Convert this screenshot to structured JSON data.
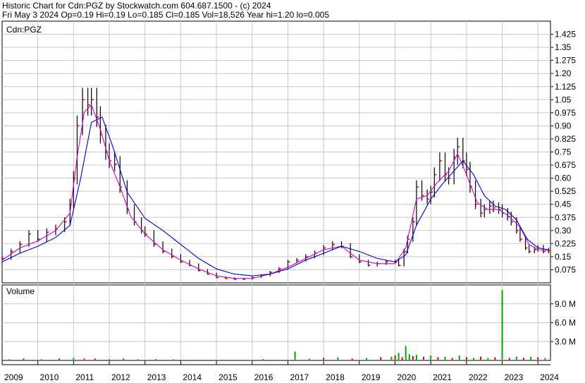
{
  "header": {
    "line1": "Historic Chart for Cdn:PGZ by Stockwatch.com 604.687.1500 - (c) 2024",
    "line2": "Fri May  3 2024   Op=0.19  Hi=0.19  Lo=0.185  Cl=0.185  Vol=18,526  Year hi=1.20  lo=0.005"
  },
  "colors": {
    "price_bar": "#000000",
    "close_tick": "#cc0000",
    "ma_short": "#cc00cc",
    "ma_long": "#0000cc",
    "volume_up": "#00aa00",
    "volume_down": "#cc0000",
    "grid": "#c8c8c8"
  },
  "chart_data": [
    {
      "type": "line",
      "title": "",
      "panel_label": "Cdn:PGZ",
      "grid": true,
      "y_ticks": [
        "1.425",
        "1.35",
        "1.275",
        "1.20",
        "1.125",
        "1.05",
        "0.975",
        "0.90",
        "0.825",
        "0.75",
        "0.675",
        "0.60",
        "0.525",
        "0.45",
        "0.375",
        "0.30",
        "0.225",
        "0.15",
        "0.075"
      ],
      "ylim": [
        0.0,
        1.5
      ],
      "xlim": [
        2009.0,
        2024.35
      ],
      "series": [
        {
          "key": "price",
          "x": [
            2009.0,
            2009.25,
            2009.5,
            2009.75,
            2010.0,
            2010.25,
            2010.5,
            2010.75,
            2010.9,
            2011.0,
            2011.1,
            2011.25,
            2011.4,
            2011.5,
            2011.65,
            2011.75,
            2011.9,
            2012.0,
            2012.15,
            2012.3,
            2012.5,
            2012.7,
            2012.9,
            2013.0,
            2013.25,
            2013.5,
            2013.75,
            2014.0,
            2014.25,
            2014.5,
            2014.75,
            2015.0,
            2015.25,
            2015.5,
            2015.75,
            2016.0,
            2016.25,
            2016.5,
            2016.75,
            2017.0,
            2017.25,
            2017.5,
            2017.75,
            2018.0,
            2018.25,
            2018.5,
            2018.75,
            2019.0,
            2019.25,
            2019.5,
            2019.75,
            2020.0,
            2020.1,
            2020.25,
            2020.35,
            2020.5,
            2020.6,
            2020.75,
            2020.9,
            2021.0,
            2021.1,
            2021.25,
            2021.4,
            2021.5,
            2021.65,
            2021.75,
            2021.9,
            2022.0,
            2022.1,
            2022.25,
            2022.4,
            2022.5,
            2022.65,
            2022.75,
            2022.9,
            2023.0,
            2023.15,
            2023.25,
            2023.4,
            2023.5,
            2023.65,
            2023.75,
            2023.9,
            2024.0,
            2024.15,
            2024.3
          ],
          "y": [
            0.14,
            0.18,
            0.22,
            0.28,
            0.25,
            0.29,
            0.31,
            0.35,
            0.45,
            0.6,
            0.9,
            1.05,
            1.02,
            1.05,
            0.95,
            0.85,
            0.75,
            0.7,
            0.68,
            0.55,
            0.42,
            0.35,
            0.3,
            0.28,
            0.22,
            0.18,
            0.15,
            0.12,
            0.1,
            0.07,
            0.05,
            0.03,
            0.025,
            0.02,
            0.02,
            0.03,
            0.04,
            0.06,
            0.08,
            0.12,
            0.13,
            0.15,
            0.17,
            0.2,
            0.22,
            0.21,
            0.15,
            0.12,
            0.1,
            0.11,
            0.12,
            0.12,
            0.1,
            0.18,
            0.25,
            0.35,
            0.55,
            0.5,
            0.48,
            0.52,
            0.62,
            0.7,
            0.62,
            0.6,
            0.72,
            0.78,
            0.7,
            0.65,
            0.55,
            0.45,
            0.4,
            0.42,
            0.44,
            0.43,
            0.42,
            0.4,
            0.38,
            0.35,
            0.3,
            0.25,
            0.2,
            0.18,
            0.19,
            0.2,
            0.18,
            0.185
          ]
        },
        {
          "key": "ma_short",
          "x": [
            2009.0,
            2009.5,
            2010.0,
            2010.5,
            2010.9,
            2011.1,
            2011.3,
            2011.5,
            2011.75,
            2012.0,
            2012.3,
            2012.6,
            2013.0,
            2013.5,
            2014.0,
            2014.5,
            2015.0,
            2015.5,
            2016.0,
            2016.5,
            2017.0,
            2017.5,
            2018.0,
            2018.5,
            2019.0,
            2019.5,
            2020.0,
            2020.3,
            2020.6,
            2020.9,
            2021.2,
            2021.5,
            2021.75,
            2022.0,
            2022.3,
            2022.6,
            2022.9,
            2023.2,
            2023.5,
            2023.75,
            2024.0,
            2024.3
          ],
          "y": [
            0.13,
            0.2,
            0.24,
            0.3,
            0.4,
            0.72,
            0.98,
            1.02,
            0.88,
            0.7,
            0.55,
            0.38,
            0.28,
            0.19,
            0.13,
            0.08,
            0.04,
            0.025,
            0.025,
            0.05,
            0.09,
            0.14,
            0.19,
            0.21,
            0.13,
            0.11,
            0.11,
            0.2,
            0.48,
            0.5,
            0.58,
            0.64,
            0.74,
            0.62,
            0.46,
            0.42,
            0.42,
            0.38,
            0.32,
            0.22,
            0.19,
            0.185
          ]
        },
        {
          "key": "ma_long",
          "x": [
            2009.0,
            2009.5,
            2010.0,
            2010.5,
            2010.9,
            2011.2,
            2011.5,
            2011.8,
            2012.1,
            2012.5,
            2013.0,
            2013.5,
            2014.0,
            2014.5,
            2015.0,
            2015.5,
            2016.0,
            2016.5,
            2017.0,
            2017.5,
            2018.0,
            2018.5,
            2019.0,
            2019.5,
            2020.0,
            2020.3,
            2020.6,
            2021.0,
            2021.3,
            2021.6,
            2021.9,
            2022.2,
            2022.5,
            2022.8,
            2023.1,
            2023.4,
            2023.7,
            2024.0,
            2024.3
          ],
          "y": [
            0.12,
            0.17,
            0.21,
            0.26,
            0.33,
            0.6,
            0.92,
            0.95,
            0.78,
            0.52,
            0.37,
            0.3,
            0.22,
            0.14,
            0.08,
            0.05,
            0.04,
            0.05,
            0.08,
            0.13,
            0.17,
            0.21,
            0.18,
            0.14,
            0.12,
            0.16,
            0.33,
            0.48,
            0.56,
            0.63,
            0.7,
            0.62,
            0.5,
            0.44,
            0.42,
            0.36,
            0.25,
            0.2,
            0.19
          ]
        }
      ]
    },
    {
      "type": "bar",
      "title": "",
      "panel_label": "Volume",
      "grid": true,
      "y_ticks": [
        "9.0 M",
        "6.0 M",
        "3.0 M"
      ],
      "ylim": [
        0,
        12.0
      ],
      "x_ticks": [
        "2009",
        "2010",
        "2011",
        "2012",
        "2013",
        "2014",
        "2015",
        "2016",
        "2017",
        "2018",
        "2019",
        "2020",
        "2021",
        "2022",
        "2023",
        "2024"
      ],
      "xlim": [
        2009.0,
        2024.35
      ],
      "series": [
        {
          "key": "volume",
          "x": [
            2009.2,
            2009.6,
            2010.1,
            2010.6,
            2011.0,
            2011.3,
            2011.6,
            2012.0,
            2012.4,
            2012.8,
            2013.3,
            2013.8,
            2014.3,
            2014.8,
            2015.3,
            2015.8,
            2016.3,
            2016.8,
            2017.2,
            2017.6,
            2018.0,
            2018.4,
            2018.8,
            2019.2,
            2019.6,
            2019.9,
            2020.0,
            2020.1,
            2020.2,
            2020.3,
            2020.4,
            2020.5,
            2020.6,
            2020.8,
            2021.0,
            2021.2,
            2021.4,
            2021.6,
            2021.8,
            2022.0,
            2022.2,
            2022.4,
            2022.6,
            2022.8,
            2023.0,
            2023.2,
            2023.4,
            2023.6,
            2023.8,
            2024.0,
            2024.2
          ],
          "values": [
            0.2,
            0.3,
            0.2,
            0.3,
            0.4,
            0.3,
            0.3,
            0.2,
            0.3,
            0.2,
            0.2,
            0.2,
            0.1,
            0.1,
            0.1,
            0.1,
            0.2,
            0.1,
            1.4,
            0.3,
            0.4,
            0.5,
            0.3,
            0.4,
            0.5,
            0.6,
            0.8,
            1.2,
            0.5,
            2.3,
            1.0,
            0.7,
            0.9,
            0.6,
            0.8,
            0.5,
            0.6,
            0.4,
            0.8,
            0.5,
            0.4,
            0.6,
            0.4,
            0.5,
            11.2,
            0.4,
            0.6,
            0.4,
            0.6,
            0.5,
            0.4
          ],
          "up": [
            true,
            false,
            true,
            false,
            true,
            false,
            false,
            true,
            false,
            true,
            false,
            true,
            false,
            true,
            false,
            true,
            false,
            true,
            true,
            true,
            false,
            true,
            false,
            true,
            false,
            true,
            false,
            true,
            false,
            true,
            true,
            false,
            true,
            false,
            true,
            false,
            true,
            false,
            true,
            false,
            true,
            false,
            true,
            false,
            true,
            false,
            true,
            false,
            true,
            false,
            true
          ]
        }
      ]
    }
  ]
}
